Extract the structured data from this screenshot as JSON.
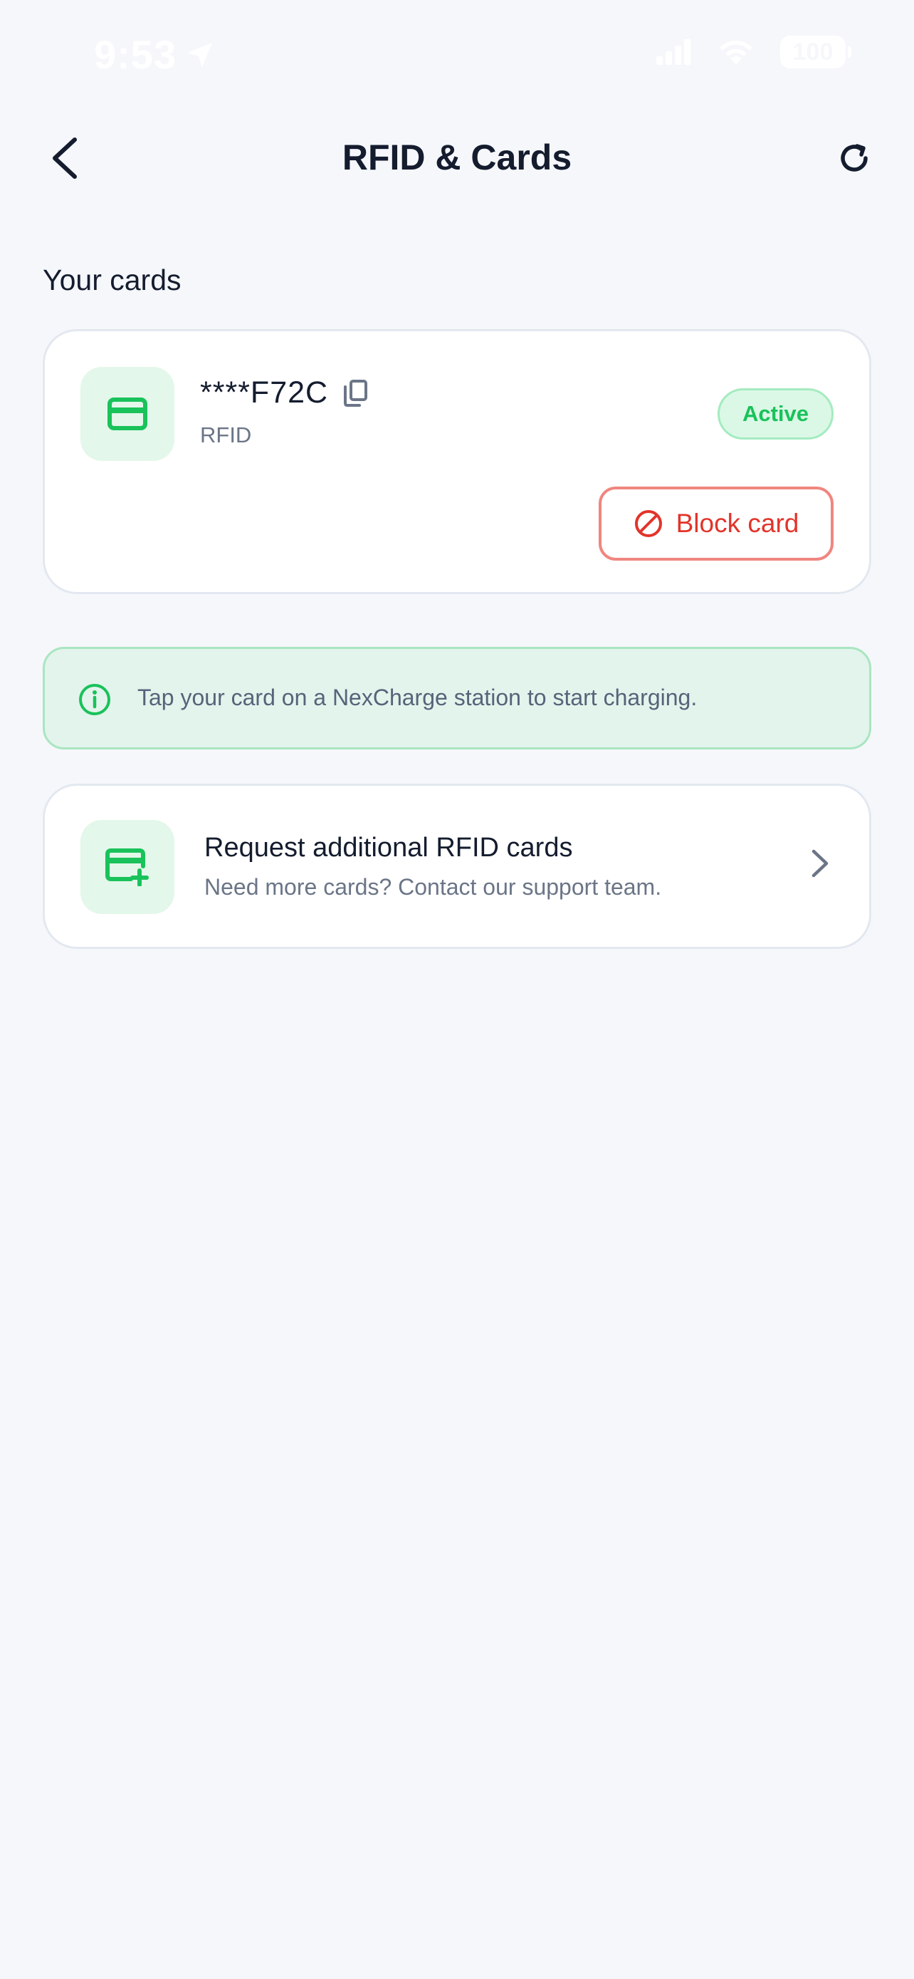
{
  "status_bar": {
    "time": "9:53",
    "battery": "100"
  },
  "header": {
    "title": "RFID & Cards"
  },
  "cards_section": {
    "title": "Your cards",
    "cards": [
      {
        "number": "****F72C",
        "type": "RFID",
        "status": "Active",
        "block_label": "Block card"
      }
    ]
  },
  "info_banner": {
    "text": "Tap your card on a NexCharge station to start charging."
  },
  "request_card": {
    "title": "Request additional RFID cards",
    "subtitle": "Need more cards? Contact our support team."
  },
  "colors": {
    "accent_green": "#19c25a",
    "danger_red": "#e2342b",
    "background": "#f5f7fb"
  }
}
